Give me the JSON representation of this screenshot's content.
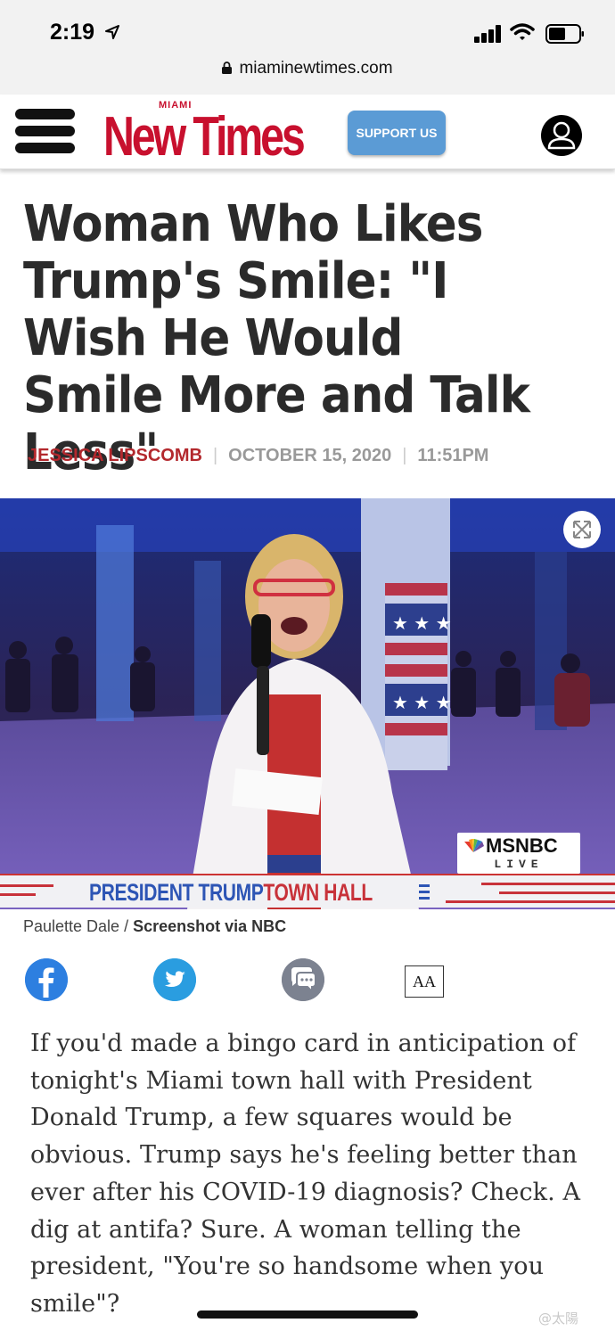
{
  "status_bar": {
    "time": "2:19",
    "url": "miaminewtimes.com"
  },
  "header": {
    "logo_top": "MIAMI",
    "logo_main": "New Times",
    "support_label": "SUPPORT US"
  },
  "article": {
    "headline": "Woman Who Likes Trump's Smile: \"I Wish He Would Smile More and Talk Less\"",
    "author": "JESSICA LIPSCOMB",
    "date": "OCTOBER 15, 2020",
    "time": "11:51PM",
    "image": {
      "network": "MSNBC",
      "live_label": "LIVE",
      "banner_part1": "PRESIDENT TRUMP",
      "banner_part2": "TOWN HALL"
    },
    "caption_person": "Paulette Dale / ",
    "caption_source": "Screenshot via NBC",
    "text_size_label": "AA",
    "body": "If you'd made a bingo card in anticipation of tonight's Miami town hall with President Donald Trump, a few squares would be obvious. Trump says he's feeling better than ever after his COVID-19 diagnosis? Check. A dig at antifa? Sure. A woman telling the president, \"You're so handsome when you smile\"?"
  },
  "colors": {
    "brand_red": "#c8102e",
    "support_blue": "#5b9bd5",
    "facebook": "#2d7fe0",
    "twitter": "#2a9de0",
    "comment": "#7c8290"
  },
  "watermark": "@太陽"
}
